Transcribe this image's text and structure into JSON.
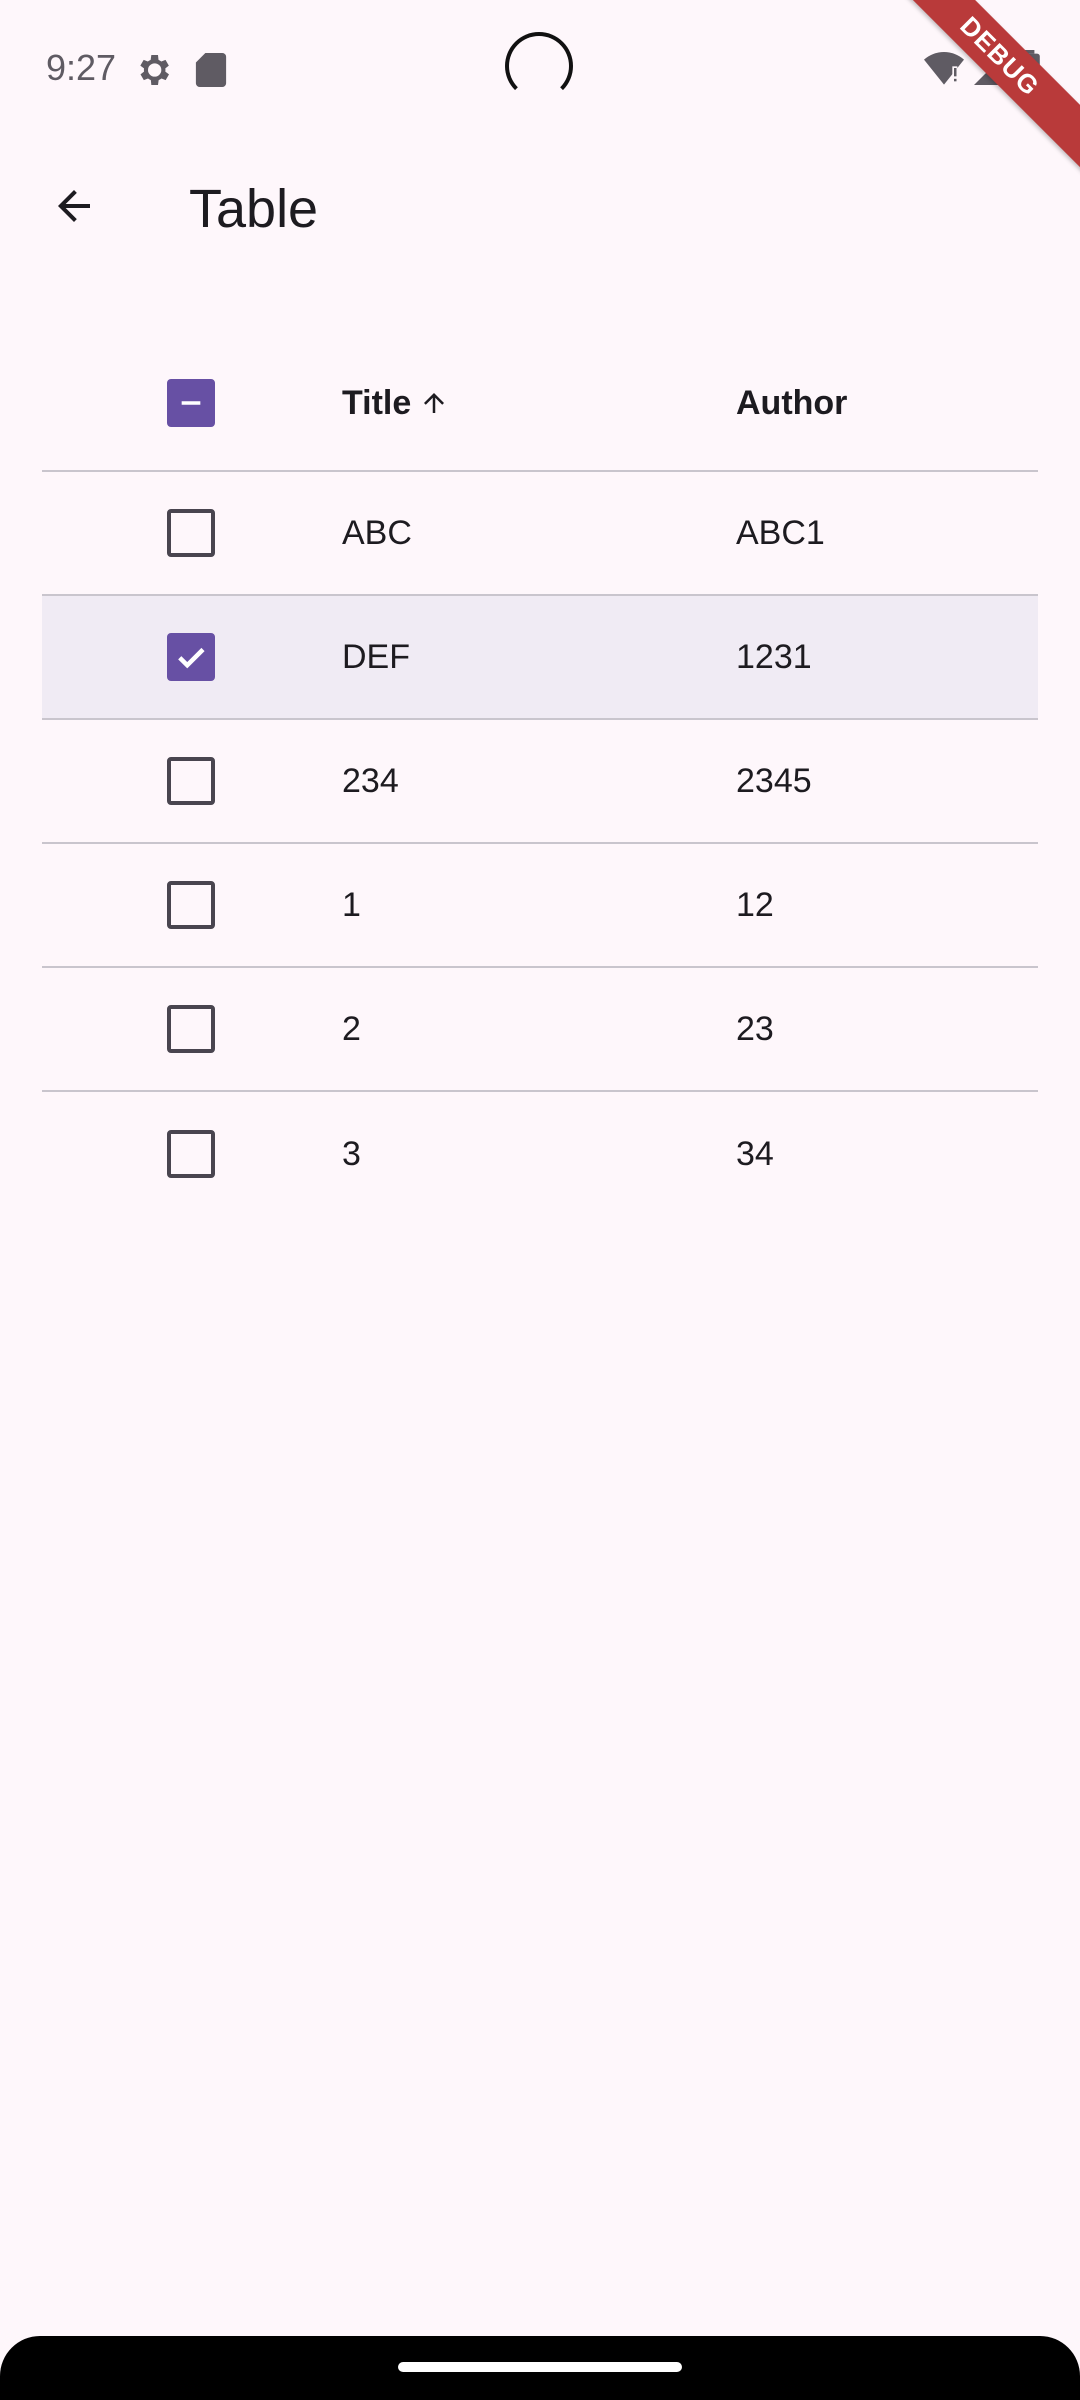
{
  "status_bar": {
    "time": "9:27",
    "icons": [
      "gear-icon",
      "sd-card-icon",
      "wifi-icon",
      "signal-icon",
      "battery-icon"
    ]
  },
  "debug_banner": "DEBUG",
  "app_bar": {
    "back_icon": "arrow-back-icon",
    "title": "Table"
  },
  "table": {
    "select_all_state": "indeterminate",
    "columns": {
      "title": "Title",
      "author": "Author",
      "sort": "ascending"
    },
    "rows": [
      {
        "title": "ABC",
        "author": "ABC1",
        "selected": false
      },
      {
        "title": "DEF",
        "author": "1231",
        "selected": true
      },
      {
        "title": "234",
        "author": "2345",
        "selected": false
      },
      {
        "title": "1",
        "author": "12",
        "selected": false
      },
      {
        "title": "2",
        "author": "23",
        "selected": false
      },
      {
        "title": "3",
        "author": "34",
        "selected": false
      }
    ]
  },
  "colors": {
    "accent": "#6750a4",
    "background": "#fef7fb",
    "selected_row": "#f0ebf4",
    "debug_banner": "#b93a3a"
  }
}
